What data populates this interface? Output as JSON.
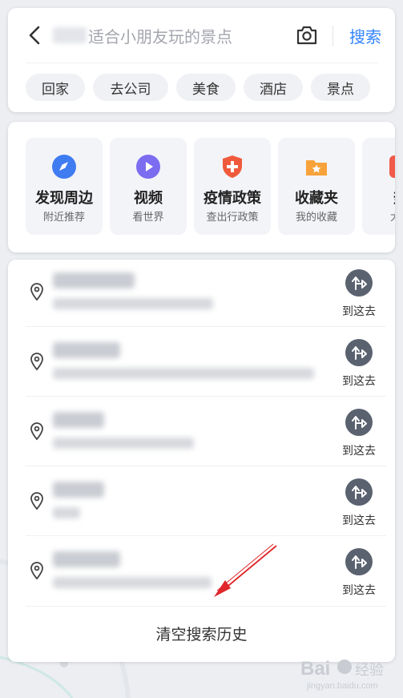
{
  "search": {
    "query_text": "适合小朋友玩的景点",
    "search_label": "搜索",
    "chips": [
      "回家",
      "去公司",
      "美食",
      "酒店",
      "景点"
    ]
  },
  "categories": [
    {
      "title": "发现周边",
      "subtitle": "附近推荐",
      "icon": "compass-icon",
      "color": "#3f7cf2"
    },
    {
      "title": "视频",
      "subtitle": "看世界",
      "icon": "play-icon",
      "color": "#7c6cf0"
    },
    {
      "title": "疫情政策",
      "subtitle": "查出行政策",
      "icon": "shield-plus-icon",
      "color": "#f05a3c"
    },
    {
      "title": "收藏夹",
      "subtitle": "我的收藏",
      "icon": "folder-star-icon",
      "color": "#f7a23a"
    },
    {
      "title": "热",
      "subtitle": "大家",
      "icon": "hot-icon",
      "color": "#f05a4a"
    }
  ],
  "history": {
    "go_label": "到这去",
    "clear_label": "清空搜索历史",
    "item_count": 5
  },
  "watermark": {
    "text_main": "Bai",
    "text_cn": "经验",
    "text_url": "jingyan.baidu.com"
  },
  "colors": {
    "accent": "#3385ff",
    "annotation": "#e0262a",
    "go_button": "#5a6270"
  }
}
